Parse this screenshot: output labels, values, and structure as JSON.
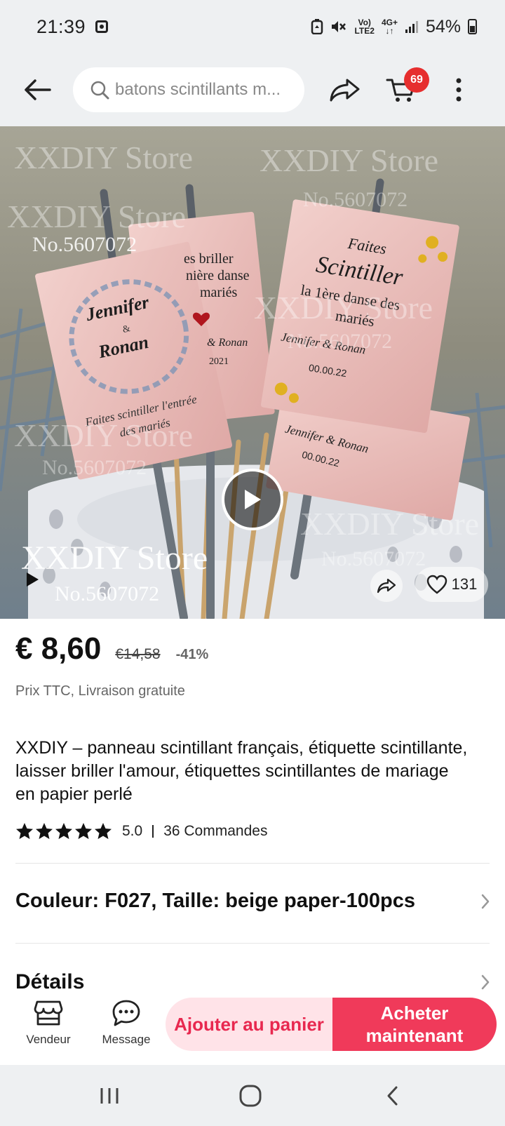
{
  "status_bar": {
    "time": "21:39",
    "network_top": "Vo)",
    "network_bottom": "LTE2",
    "network_type": "4G+",
    "battery": "54%"
  },
  "top_nav": {
    "search_text": "batons scintillants m...",
    "cart_count": "69",
    "icons": [
      "back-arrow-icon",
      "search-icon",
      "share-icon",
      "cart-icon",
      "more-vertical-icon"
    ]
  },
  "gallery": {
    "watermarks": {
      "store": "XXDIY Store",
      "number": "No.5607072"
    },
    "card_texts": {
      "card1_name1": "Jennifer",
      "card1_amp": "&",
      "card1_name2": "Ronan",
      "card1_caption1": "Faites scintiller l'entrée",
      "card1_caption2": "des mariés",
      "card2_line1": "es briller",
      "card2_line2": "nière danse",
      "card2_line3": "mariés",
      "card2_line4": "& Ronan",
      "card2_line5": "2021",
      "card3_line1": "Faites",
      "card3_line2": "Scintiller",
      "card3_line3": "la 1ère danse des",
      "card3_line4": "mariés",
      "card3_line5": "Jennifer & Ronan",
      "card3_line6": "00.00.22",
      "card4_line1": "Jennifer & Ronan",
      "card4_line2": "00.00.22"
    },
    "likes": "131"
  },
  "product": {
    "price": "€ 8,60",
    "old_price": "€14,58",
    "discount": "-41%",
    "tax_note": "Prix TTC, Livraison gratuite",
    "title": "XXDIY – panneau scintillant français, étiquette scintillante, laisser briller l'amour, étiquettes scintillantes de mariage en papier perlé",
    "rating": "5.0",
    "rating_stars": 5,
    "orders": "36 Commandes",
    "variant": "Couleur: F027, Taille: beige paper-100pcs",
    "details_label": "Détails"
  },
  "bottom_bar": {
    "vendor_label": "Vendeur",
    "message_label": "Message",
    "add_to_cart": "Ajouter au panier",
    "buy_now": "Acheter maintenant"
  },
  "colors": {
    "accent": "#f03a5a",
    "accent_light": "#ffe3e8",
    "badge": "#e62e2e"
  }
}
